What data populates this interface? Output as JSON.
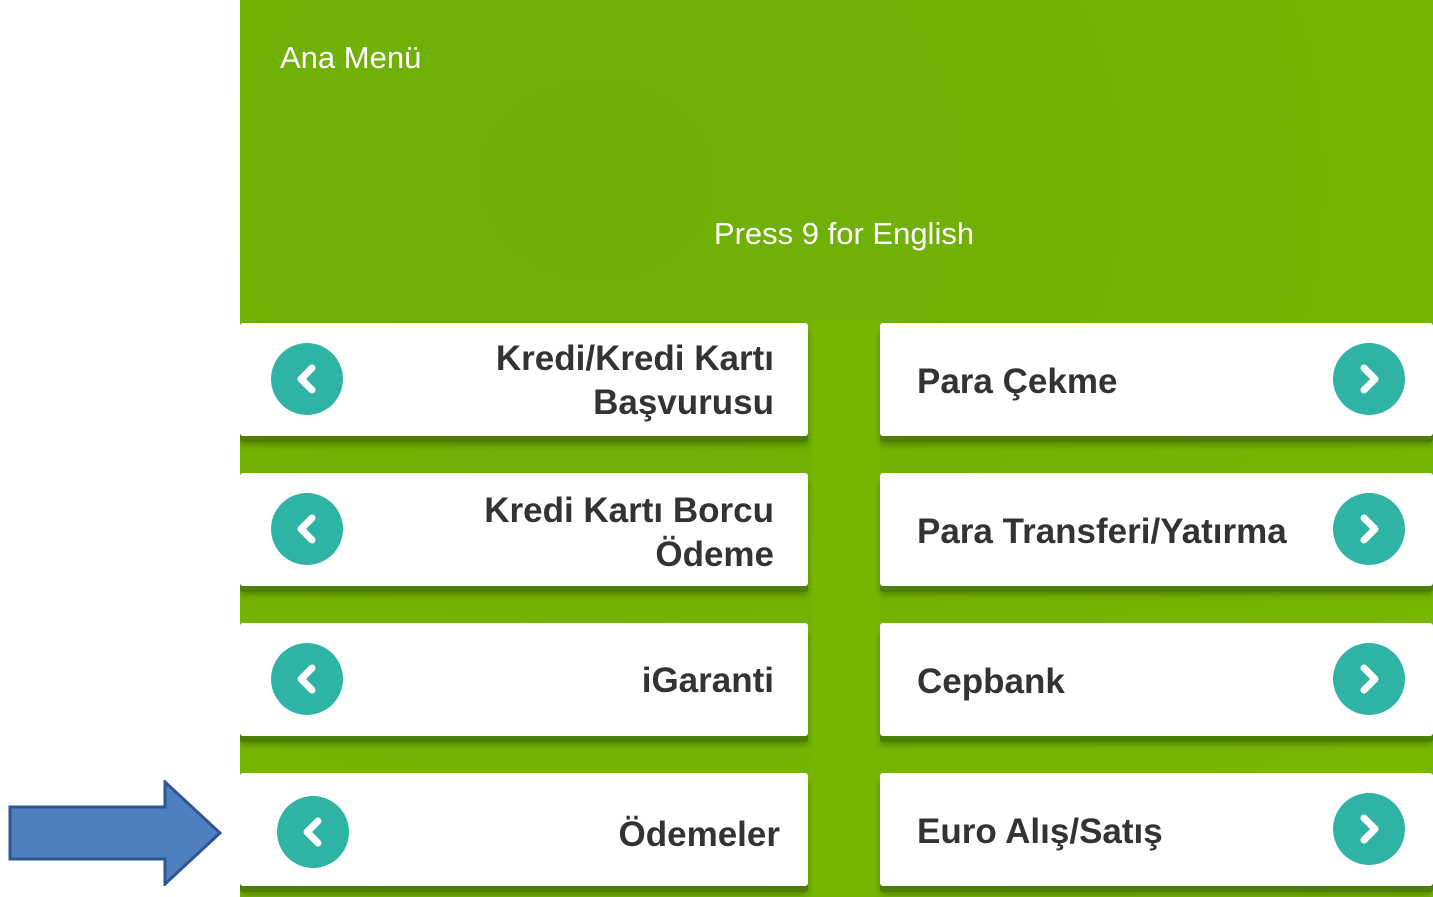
{
  "screen": {
    "title": "Ana Menü",
    "english_hint": "Press 9 for English"
  },
  "left_buttons": [
    {
      "line1": "Kredi/Kredi Kartı",
      "line2": "Başvurusu"
    },
    {
      "line1": "Kredi Kartı Borcu",
      "line2": "Ödeme"
    },
    {
      "line1": "iGaranti",
      "line2": ""
    },
    {
      "line1": "Ödemeler",
      "line2": ""
    }
  ],
  "right_buttons": [
    {
      "label": "Para Çekme"
    },
    {
      "label": "Para Transferi/Yatırma"
    },
    {
      "label": "Cepbank"
    },
    {
      "label": "Euro Alış/Satış"
    }
  ],
  "colors": {
    "background_green": "#76b500",
    "button_circle": "#2fb3a4",
    "arrow_fill": "#4f7fbe",
    "arrow_stroke": "#2f5597"
  },
  "icons": {
    "left_button_icon": "chevron-left-icon",
    "right_button_icon": "chevron-right-icon",
    "pointer": "pointer-arrow"
  }
}
